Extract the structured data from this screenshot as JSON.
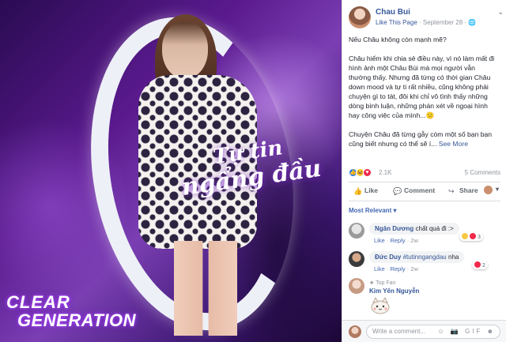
{
  "photo": {
    "slogan_line1": "Tự tin",
    "slogan_line2": "ngẩng đầu",
    "brand_line1": "CLEAR",
    "brand_line2": "GENERATION"
  },
  "post": {
    "page_name": "Chau Bui",
    "like_page": "Like This Page",
    "date": "September 28",
    "separator": "·",
    "globe": "🌐",
    "menu_chevron": "⌄",
    "paragraph1": "Nếu Châu không còn mạnh mẽ?",
    "paragraph2": "Châu hiếm khi chia sẻ điều này, vì nó làm mất đi hình ảnh một Châu Bùi mà mọi người vẫn thường thấy. Nhưng đã từng có thời gian Châu down mood và tự ti rất nhiều, cũng không phải chuyện gì to tát, đôi khi chỉ vô tình thấy những dòng bình luận, những phán xét về ngoại hình hay công việc của mình...😕",
    "paragraph3": "Chuyện Châu đã từng gẫy còm một số bạn bạn cũng biết nhưng có thể sẽ í...",
    "see_more": "See More",
    "reaction_count": "2.1K",
    "comment_count": "5 Comments"
  },
  "actions": {
    "like": "Like",
    "comment": "Comment",
    "share": "Share",
    "like_icon": "👍",
    "comment_icon": "💬",
    "share_icon": "↪",
    "caret": "▾"
  },
  "comments_filter": "Most Relevant ▾",
  "comments": [
    {
      "name": "Ngân Dương",
      "text": "chất quá đi :>",
      "meta_like": "Like",
      "meta_reply": "Reply",
      "meta_time": "2w",
      "reactions": "3"
    },
    {
      "name": "Đức Duy",
      "tag": "#tutinngangdau",
      "text": "nha",
      "meta_like": "Like",
      "meta_reply": "Reply",
      "meta_time": "2w",
      "reactions": "2"
    },
    {
      "badge": "Top Fan",
      "name": "Kim Yến Nguyễn"
    }
  ],
  "composer": {
    "placeholder": "Write a comment...",
    "icons": "☺ 📷 GIF ☻"
  },
  "colors": {
    "link": "#365899",
    "like_blue": "#2078f4",
    "love_red": "#f0284a",
    "haha_yellow": "#f7c843",
    "photo_purple": "#5a1a8e"
  }
}
